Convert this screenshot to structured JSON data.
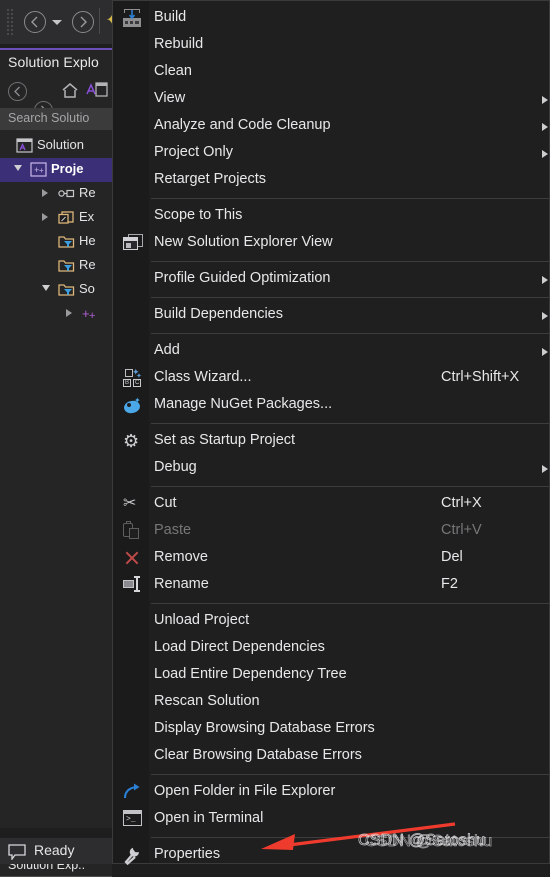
{
  "app": {
    "status_text": "Ready",
    "colors": {
      "menu_bg": "#1f1f1f",
      "gutter_bg": "#1b1b1b",
      "panel_bg": "#252526",
      "toolbar_bg": "#2d2d30",
      "accent_purple": "#6b4fb8",
      "selection": "#3b3077",
      "text": "#e8e8ea",
      "text_disabled": "#777779",
      "separator": "#3d3d3f",
      "arrow_red": "#ef3b2d",
      "folder_yellow": "#dcb67a",
      "nuget_blue": "#4aa8e8"
    }
  },
  "toolbar": {
    "grip": "drag-grip",
    "back_label": "Navigate Backward",
    "dropdown_label": "Navigate Backward Dropdown",
    "forward_label": "Navigate Forward",
    "extra_icon": "sparkle-icon"
  },
  "solution_explorer": {
    "title": "Solution Explo",
    "search_placeholder": "Search Solutio",
    "footer_label": "Solution Exp..",
    "toolbuttons": [
      {
        "name": "back-icon"
      },
      {
        "name": "forward-icon"
      },
      {
        "name": "home-icon"
      },
      {
        "name": "solution-icon"
      }
    ],
    "tree": [
      {
        "label": "Solution",
        "indent": 16,
        "twist": "none",
        "icon": "solution-icon",
        "selected": false,
        "bold": false
      },
      {
        "label": "Proje",
        "indent": 30,
        "twist": "open",
        "icon": "project-icon",
        "selected": true,
        "bold": true
      },
      {
        "label": "Re",
        "indent": 58,
        "twist": "closed",
        "icon": "references-icon",
        "selected": false,
        "bold": false
      },
      {
        "label": "Ex",
        "indent": 58,
        "twist": "closed",
        "icon": "external-icon",
        "selected": false,
        "bold": false
      },
      {
        "label": "He",
        "indent": 58,
        "twist": "none",
        "icon": "filter-folder-icon",
        "selected": false,
        "bold": false
      },
      {
        "label": "Re",
        "indent": 58,
        "twist": "none",
        "icon": "filter-folder-icon",
        "selected": false,
        "bold": false
      },
      {
        "label": "So",
        "indent": 58,
        "twist": "open",
        "icon": "filter-folder-icon",
        "selected": false,
        "bold": false
      },
      {
        "label": "",
        "indent": 82,
        "twist": "closed",
        "icon": "cpp-file-icon",
        "selected": false,
        "bold": false
      }
    ]
  },
  "context_menu": {
    "items": [
      {
        "label": "Build",
        "icon": "build-icon",
        "shortcut": "",
        "submenu": false,
        "disabled": false,
        "sep_after": false
      },
      {
        "label": "Rebuild",
        "icon": "",
        "shortcut": "",
        "submenu": false,
        "disabled": false,
        "sep_after": false
      },
      {
        "label": "Clean",
        "icon": "",
        "shortcut": "",
        "submenu": false,
        "disabled": false,
        "sep_after": false
      },
      {
        "label": "View",
        "icon": "",
        "shortcut": "",
        "submenu": true,
        "disabled": false,
        "sep_after": false
      },
      {
        "label": "Analyze and Code Cleanup",
        "icon": "",
        "shortcut": "",
        "submenu": true,
        "disabled": false,
        "sep_after": false
      },
      {
        "label": "Project Only",
        "icon": "",
        "shortcut": "",
        "submenu": true,
        "disabled": false,
        "sep_after": false
      },
      {
        "label": "Retarget Projects",
        "icon": "",
        "shortcut": "",
        "submenu": false,
        "disabled": false,
        "sep_after": true
      },
      {
        "label": "Scope to This",
        "icon": "",
        "shortcut": "",
        "submenu": false,
        "disabled": false,
        "sep_after": false
      },
      {
        "label": "New Solution Explorer View",
        "icon": "window-icon",
        "shortcut": "",
        "submenu": false,
        "disabled": false,
        "sep_after": true
      },
      {
        "label": "Profile Guided Optimization",
        "icon": "",
        "shortcut": "",
        "submenu": true,
        "disabled": false,
        "sep_after": true
      },
      {
        "label": "Build Dependencies",
        "icon": "",
        "shortcut": "",
        "submenu": true,
        "disabled": false,
        "sep_after": true
      },
      {
        "label": "Add",
        "icon": "",
        "shortcut": "",
        "submenu": true,
        "disabled": false,
        "sep_after": false
      },
      {
        "label": "Class Wizard...",
        "icon": "class-wizard-icon",
        "shortcut": "Ctrl+Shift+X",
        "submenu": false,
        "disabled": false,
        "sep_after": false
      },
      {
        "label": "Manage NuGet Packages...",
        "icon": "nuget-icon",
        "shortcut": "",
        "submenu": false,
        "disabled": false,
        "sep_after": true
      },
      {
        "label": "Set as Startup Project",
        "icon": "gear-icon",
        "shortcut": "",
        "submenu": false,
        "disabled": false,
        "sep_after": false
      },
      {
        "label": "Debug",
        "icon": "",
        "shortcut": "",
        "submenu": true,
        "disabled": false,
        "sep_after": true
      },
      {
        "label": "Cut",
        "icon": "scissors-icon",
        "shortcut": "Ctrl+X",
        "submenu": false,
        "disabled": false,
        "sep_after": false
      },
      {
        "label": "Paste",
        "icon": "paste-icon",
        "shortcut": "Ctrl+V",
        "submenu": false,
        "disabled": true,
        "sep_after": false
      },
      {
        "label": "Remove",
        "icon": "remove-x-icon",
        "shortcut": "Del",
        "submenu": false,
        "disabled": false,
        "sep_after": false
      },
      {
        "label": "Rename",
        "icon": "rename-icon",
        "shortcut": "F2",
        "submenu": false,
        "disabled": false,
        "sep_after": true
      },
      {
        "label": "Unload Project",
        "icon": "",
        "shortcut": "",
        "submenu": false,
        "disabled": false,
        "sep_after": false
      },
      {
        "label": "Load Direct Dependencies",
        "icon": "",
        "shortcut": "",
        "submenu": false,
        "disabled": false,
        "sep_after": false
      },
      {
        "label": "Load Entire Dependency Tree",
        "icon": "",
        "shortcut": "",
        "submenu": false,
        "disabled": false,
        "sep_after": false
      },
      {
        "label": "Rescan Solution",
        "icon": "",
        "shortcut": "",
        "submenu": false,
        "disabled": false,
        "sep_after": false
      },
      {
        "label": "Display Browsing Database Errors",
        "icon": "",
        "shortcut": "",
        "submenu": false,
        "disabled": false,
        "sep_after": false
      },
      {
        "label": "Clear Browsing Database Errors",
        "icon": "",
        "shortcut": "",
        "submenu": false,
        "disabled": false,
        "sep_after": true
      },
      {
        "label": "Open Folder in File Explorer",
        "icon": "open-folder-icon",
        "shortcut": "",
        "submenu": false,
        "disabled": false,
        "sep_after": false
      },
      {
        "label": "Open in Terminal",
        "icon": "terminal-icon",
        "shortcut": "",
        "submenu": false,
        "disabled": false,
        "sep_after": true
      },
      {
        "label": "Properties",
        "icon": "wrench-icon",
        "shortcut": "",
        "submenu": false,
        "disabled": false,
        "sep_after": false
      }
    ]
  },
  "annotation": {
    "arrow_name": "red-pointer-arrow",
    "points_at": "Properties"
  },
  "watermark": {
    "text": "CSDN @Satoshu"
  }
}
